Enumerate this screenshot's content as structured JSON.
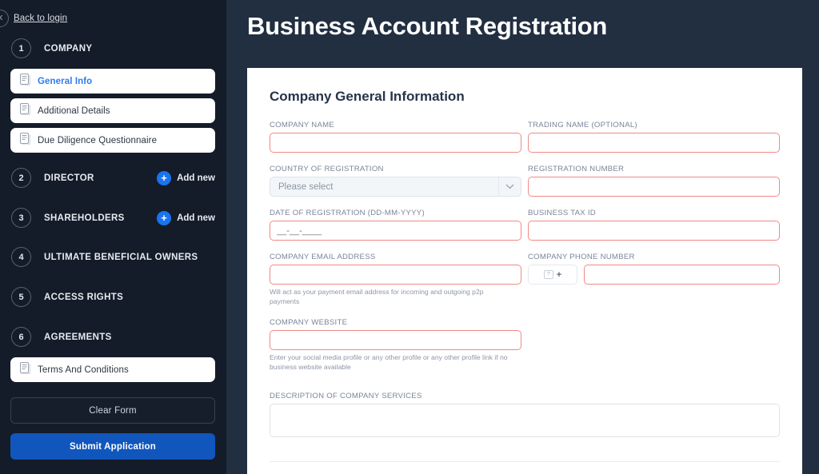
{
  "sidebar": {
    "back_label": "Back to login",
    "close_icon": "close-icon",
    "steps": [
      {
        "num": "1",
        "label": "COMPANY",
        "add_new": null
      },
      {
        "num": "2",
        "label": "DIRECTOR",
        "add_new": "Add new"
      },
      {
        "num": "3",
        "label": "SHAREHOLDERS",
        "add_new": "Add new"
      },
      {
        "num": "4",
        "label": "ULTIMATE BENEFICIAL OWNERS",
        "add_new": null
      },
      {
        "num": "5",
        "label": "ACCESS RIGHTS",
        "add_new": null
      },
      {
        "num": "6",
        "label": "AGREEMENTS",
        "add_new": null
      }
    ],
    "company_docs": [
      {
        "label": "General Info",
        "icon": "document-icon",
        "active": true
      },
      {
        "label": "Additional Details",
        "icon": "document-icon",
        "active": false
      },
      {
        "label": "Due Diligence Questionnaire",
        "icon": "document-icon",
        "active": false
      }
    ],
    "agreement_docs": [
      {
        "label": "Terms And Conditions",
        "icon": "document-icon",
        "active": false
      }
    ],
    "clear_form_label": "Clear Form",
    "submit_label": "Submit Application"
  },
  "header": {
    "title": "Business Account Registration"
  },
  "form": {
    "section_title": "Company General Information",
    "company_name": {
      "label": "COMPANY NAME",
      "value": "",
      "placeholder": ""
    },
    "trading_name": {
      "label": "TRADING NAME (OPTIONAL)",
      "value": "",
      "placeholder": ""
    },
    "country_of_registration": {
      "label": "COUNTRY OF REGISTRATION",
      "selected": "Please select",
      "chevron": "chevron-down-icon"
    },
    "registration_number": {
      "label": "REGISTRATION NUMBER",
      "value": "",
      "placeholder": ""
    },
    "date_of_registration": {
      "label": "DATE OF REGISTRATION (DD-MM-YYYY)",
      "value": "",
      "placeholder": "__-__-____"
    },
    "business_tax_id": {
      "label": "BUSINESS TAX ID",
      "value": "",
      "placeholder": ""
    },
    "company_email": {
      "label": "COMPANY EMAIL ADDRESS",
      "value": "",
      "placeholder": "",
      "hint": "Will act as your payment email address for incoming and outgoing p2p payments"
    },
    "company_phone": {
      "label": "COMPANY PHONE NUMBER",
      "prefix_flag": "?",
      "prefix_plus": "+",
      "value": "",
      "placeholder": ""
    },
    "company_website": {
      "label": "COMPANY WEBSITE",
      "value": "",
      "placeholder": "",
      "hint": "Enter your social media profile or any other profile or any other profile link if no business website available"
    },
    "description_of_services": {
      "label": "DESCRIPTION OF COMPANY SERVICES",
      "value": "",
      "placeholder": ""
    }
  },
  "colors": {
    "page_background": "#222f41",
    "sidebar_background": "#141c29",
    "accent_blue": "#1a73f0",
    "submit_blue": "#1156bd",
    "error_border": "#ef8a86",
    "link_blue": "#2f7bf0"
  }
}
